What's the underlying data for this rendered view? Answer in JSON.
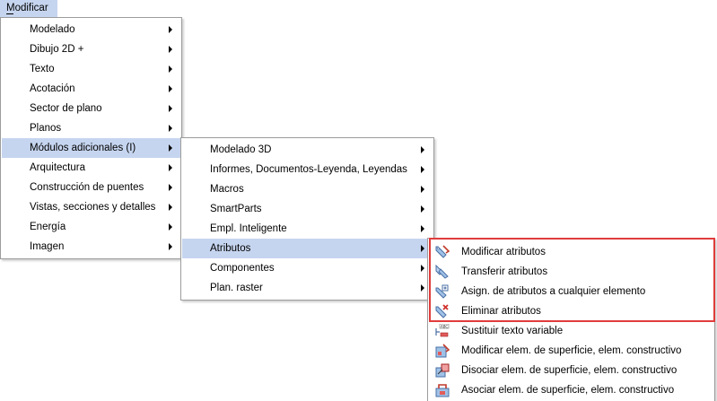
{
  "menubar": {
    "modificar": "Modificar"
  },
  "menu1": {
    "items": [
      {
        "label": "Modelado",
        "submenu": true
      },
      {
        "label": "Dibujo 2D +",
        "submenu": true
      },
      {
        "label": "Texto",
        "submenu": true
      },
      {
        "label": "Acotación",
        "submenu": true
      },
      {
        "label": "Sector de plano",
        "submenu": true
      },
      {
        "label": "Planos",
        "submenu": true
      },
      {
        "label": "Módulos adicionales (I)",
        "submenu": true,
        "selected": true
      },
      {
        "label": "Arquitectura",
        "submenu": true
      },
      {
        "label": "Construcción de puentes",
        "submenu": true
      },
      {
        "label": "Vistas, secciones y detalles",
        "submenu": true
      },
      {
        "label": "Energía",
        "submenu": true
      },
      {
        "label": "Imagen",
        "submenu": true
      }
    ]
  },
  "menu2": {
    "items": [
      {
        "label": "Modelado 3D",
        "submenu": true
      },
      {
        "label": "Informes, Documentos-Leyenda, Leyendas",
        "submenu": true
      },
      {
        "label": "Macros",
        "submenu": true
      },
      {
        "label": "SmartParts",
        "submenu": true
      },
      {
        "label": "Empl. Inteligente",
        "submenu": true
      },
      {
        "label": "Atributos",
        "submenu": true,
        "selected": true
      },
      {
        "label": "Componentes",
        "submenu": true
      },
      {
        "label": "Plan. raster",
        "submenu": true
      }
    ]
  },
  "menu3": {
    "items": [
      {
        "label": "Modificar atributos",
        "icon": "modify-attributes-icon"
      },
      {
        "label": "Transferir atributos",
        "icon": "transfer-attributes-icon"
      },
      {
        "label": "Asign. de atributos a cualquier elemento",
        "icon": "assign-attributes-icon"
      },
      {
        "label": "Eliminar atributos",
        "icon": "delete-attributes-icon"
      },
      {
        "label": "Sustituir texto variable",
        "icon": "replace-variable-text-icon"
      },
      {
        "label": "Modificar elem. de superficie, elem. constructivo",
        "icon": "modify-surface-element-icon"
      },
      {
        "label": "Disociar elem. de superficie, elem. constructivo",
        "icon": "dissociate-surface-element-icon"
      },
      {
        "label": "Asociar elem. de superficie, elem. constructivo",
        "icon": "associate-surface-element-icon"
      }
    ]
  },
  "colors": {
    "selection": "#c6d5ef",
    "highlight_border": "#e03c3c"
  }
}
